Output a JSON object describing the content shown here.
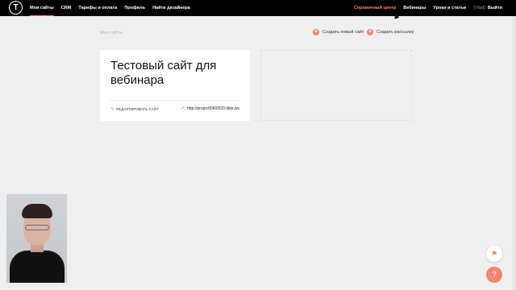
{
  "topbar": {
    "logo_letter": "T",
    "left_items": [
      "Мои сайты",
      "CRM",
      "Тарифы и оплата",
      "Профиль",
      "Найти дизайнера"
    ],
    "right_items": [
      "Справочный центр",
      "Вебинары",
      "Уроки и статьи"
    ],
    "user_label": "(Vlad)",
    "exit_label": "Выйти"
  },
  "breadcrumb": "Мои сайты",
  "actions": {
    "create_site": "Создать новый сайт",
    "create_mailing": "Создать рассылку"
  },
  "site_card": {
    "title": "Тестовый сайт для вебинара",
    "edit_label": "РЕДАКТИРОВАТЬ САЙТ",
    "url": "http://project5960520.tilda.ws"
  },
  "colors": {
    "accent": "#f4846b",
    "topbar": "#000000",
    "background": "#efefef"
  },
  "icons": {
    "fab_top": "flag-icon",
    "fab_bottom": "question-icon"
  }
}
